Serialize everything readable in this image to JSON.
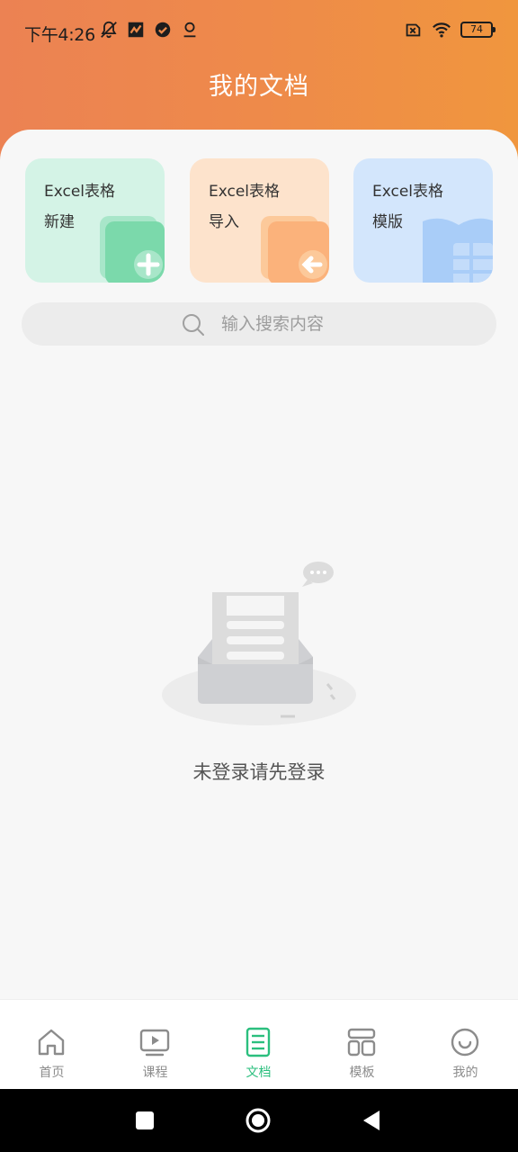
{
  "status_bar": {
    "time": "下午4:26",
    "battery": "74",
    "left_icons": [
      "mute-bell-icon",
      "app-notification-icon",
      "check-badge-icon",
      "location-pin-icon"
    ],
    "right_icons": [
      "sim-blocked-icon",
      "wifi-icon",
      "battery-icon"
    ]
  },
  "header": {
    "title": "我的文档"
  },
  "cards": [
    {
      "line1": "Excel表格",
      "line2": "新建",
      "icon": "new-doc-plus-icon",
      "color": "#d4f3e6"
    },
    {
      "line1": "Excel表格",
      "line2": "导入",
      "icon": "import-doc-icon",
      "color": "#fde3cc"
    },
    {
      "line1": "Excel表格",
      "line2": "模版",
      "icon": "template-book-icon",
      "color": "#d3e6fc"
    }
  ],
  "search": {
    "placeholder": "输入搜索内容"
  },
  "empty_state": {
    "message": "未登录请先登录"
  },
  "bottom_nav": {
    "items": [
      {
        "label": "首页",
        "icon": "home-icon",
        "active": false
      },
      {
        "label": "课程",
        "icon": "video-play-icon",
        "active": false
      },
      {
        "label": "文档",
        "icon": "document-icon",
        "active": true
      },
      {
        "label": "模板",
        "icon": "template-grid-icon",
        "active": false
      },
      {
        "label": "我的",
        "icon": "smile-icon",
        "active": false
      }
    ]
  },
  "colors": {
    "header_start": "#ec8253",
    "header_end": "#f0963e",
    "accent_green": "#2bbf7e",
    "inactive_nav": "#8c8c8c"
  }
}
